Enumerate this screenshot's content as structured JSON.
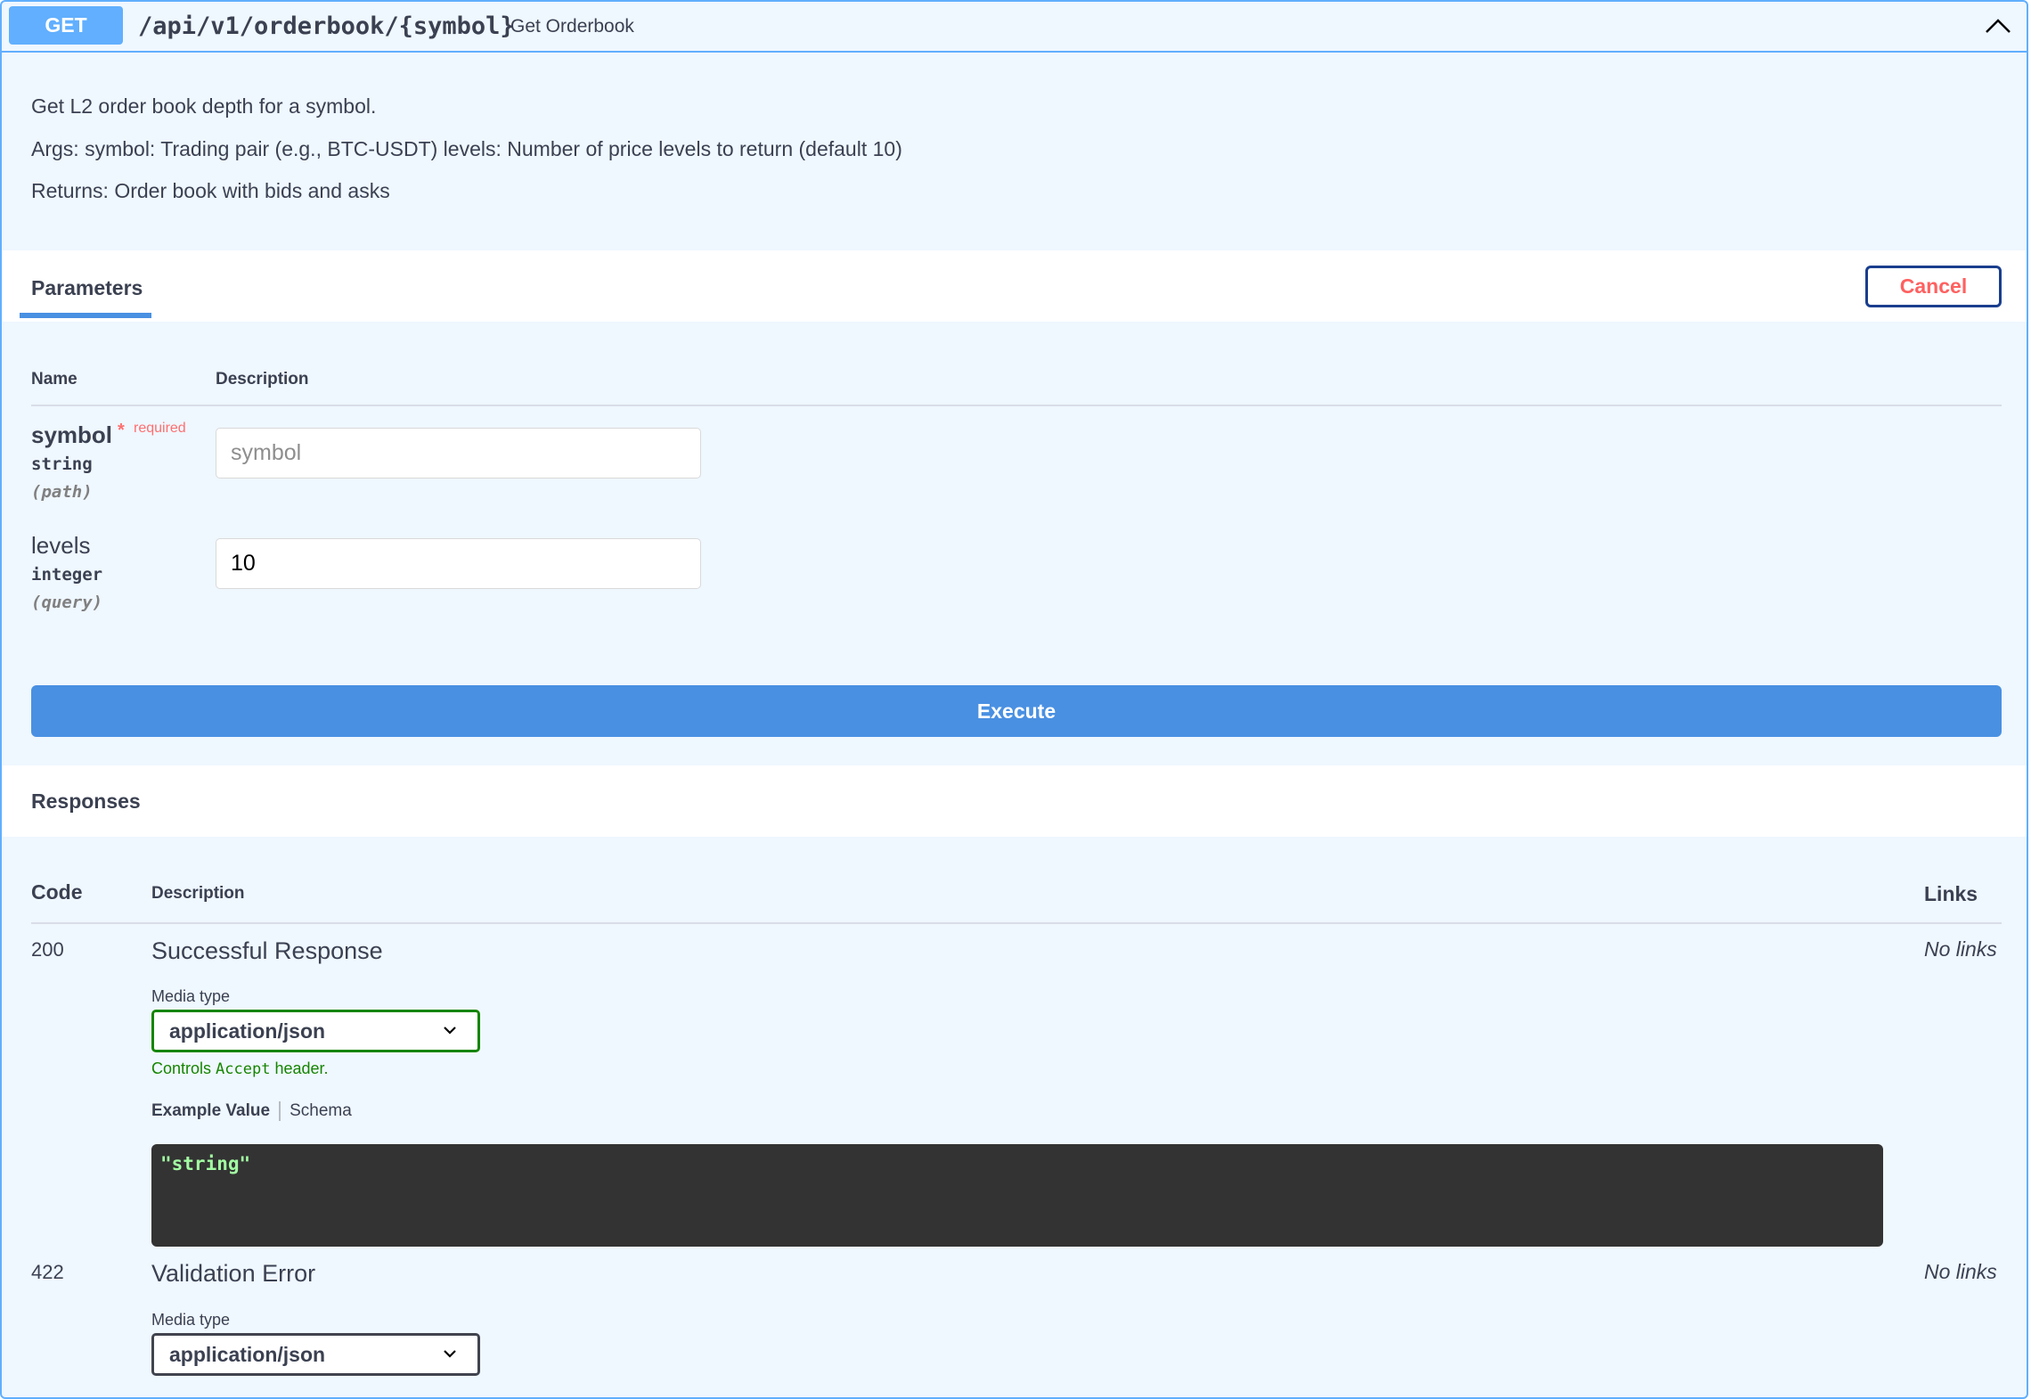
{
  "operation": {
    "method": "GET",
    "path": "/api/v1/orderbook/{symbol}",
    "summary": "Get Orderbook"
  },
  "description": {
    "line1": "Get L2 order book depth for a symbol.",
    "line2": "Args: symbol: Trading pair (e.g., BTC-USDT) levels: Number of price levels to return (default 10)",
    "line3": "Returns: Order book with bids and asks"
  },
  "parameters": {
    "title": "Parameters",
    "cancel_label": "Cancel",
    "col_name": "Name",
    "col_description": "Description",
    "items": [
      {
        "name": "symbol",
        "required_mark": "*",
        "required_label": "required",
        "type": "string",
        "in": "(path)",
        "placeholder": "symbol",
        "value": ""
      },
      {
        "name": "levels",
        "type": "integer",
        "in": "(query)",
        "placeholder": "levels",
        "value": "10"
      }
    ]
  },
  "execute_label": "Execute",
  "responses": {
    "title": "Responses",
    "col_code": "Code",
    "col_description": "Description",
    "col_links": "Links",
    "items": [
      {
        "code": "200",
        "description": "Successful Response",
        "media_type_label": "Media type",
        "media_type": "application/json",
        "controls_prefix": "Controls",
        "controls_code": "Accept",
        "controls_suffix": "header.",
        "example_tab": "Example Value",
        "schema_tab": "Schema",
        "example_value": "\"string\"",
        "links": "No links"
      },
      {
        "code": "422",
        "description": "Validation Error",
        "media_type_label": "Media type",
        "media_type": "application/json",
        "links": "No links"
      }
    ]
  },
  "colors": {
    "get_accent": "#61affe",
    "execute_blue": "#4990e2",
    "cancel_red": "#ff6060",
    "accept_green": "#158500"
  }
}
